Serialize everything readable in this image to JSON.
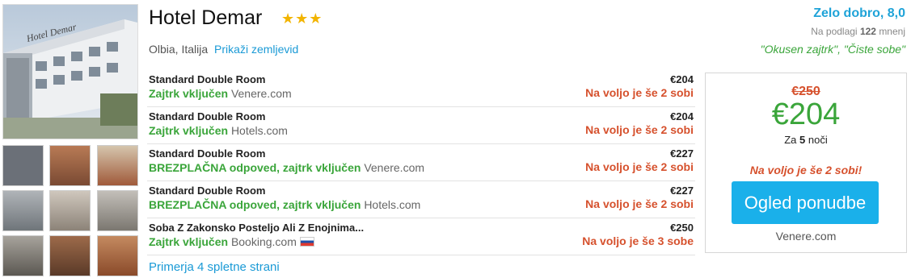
{
  "hotel": {
    "name": "Hotel Demar",
    "stars": "★★★",
    "location": "Olbia, Italija",
    "map_link": "Prikaži zemljevid",
    "photo_sign": "Hotel Demar"
  },
  "rating": {
    "label": "Zelo dobro, 8,0",
    "reviews_prefix": "Na podlagi",
    "reviews_count": "122",
    "reviews_suffix": "mnenj",
    "quotes": "\"Okusen zajtrk\", \"Čiste sobe\""
  },
  "offers": [
    {
      "room": "Standard Double Room",
      "perk": "Zajtrk vključen",
      "site": "Venere.com",
      "price": "€204",
      "availability": "Na voljo je še 2 sobi"
    },
    {
      "room": "Standard Double Room",
      "perk": "Zajtrk vključen",
      "site": "Hotels.com",
      "price": "€204",
      "availability": "Na voljo je še 2 sobi"
    },
    {
      "room": "Standard Double Room",
      "perk": "BREZPLAČNA odpoved, zajtrk vključen",
      "site": "Venere.com",
      "price": "€227",
      "availability": "Na voljo je še 2 sobi"
    },
    {
      "room": "Standard Double Room",
      "perk": "BREZPLAČNA odpoved, zajtrk vključen",
      "site": "Hotels.com",
      "price": "€227",
      "availability": "Na voljo je še 2 sobi"
    },
    {
      "room": "Soba Z Zakonsko Posteljo Ali Z Enojnima...",
      "perk": "Zajtrk vključen",
      "site": "Booking.com",
      "price": "€250",
      "availability": "Na voljo je še 3 sobe"
    }
  ],
  "compare_link": "Primerja 4 spletne strani",
  "deal": {
    "old_price": "€250",
    "price": "€204",
    "nights_prefix": "Za",
    "nights_count": "5",
    "nights_suffix": "noči",
    "availability": "Na voljo je še 2 sobi!",
    "cta": "Ogled ponudbe",
    "site": "Venere.com"
  },
  "colors": {
    "accent_blue": "#1ab0ea",
    "green": "#3aa53a",
    "warning": "#d6512d",
    "stars": "#f2b400"
  }
}
